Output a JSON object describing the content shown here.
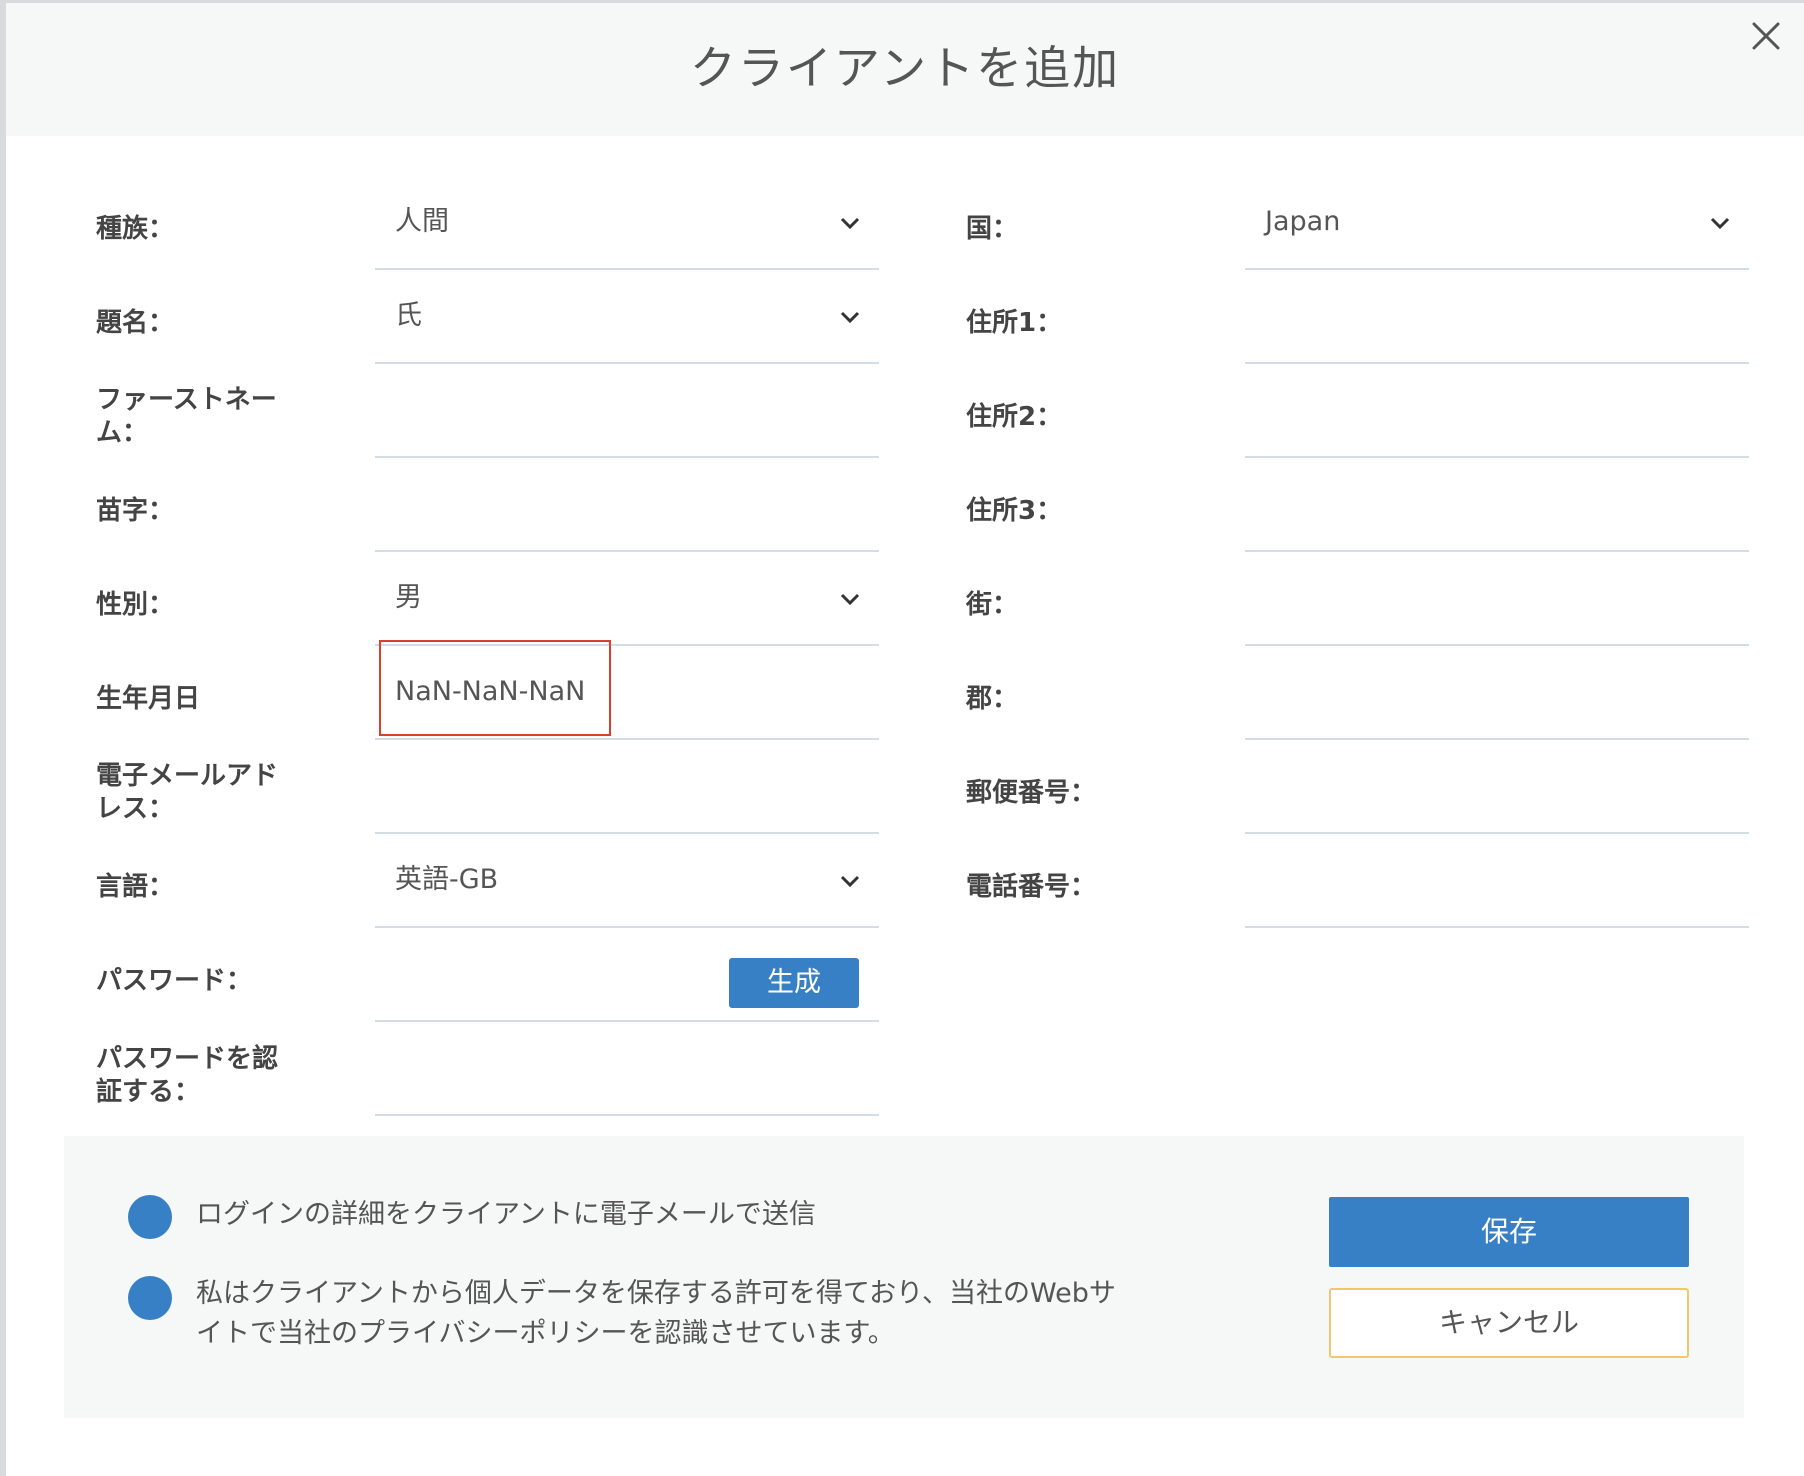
{
  "modal": {
    "title": "クライアントを追加"
  },
  "left": {
    "race": {
      "label": "種族：",
      "value": "人間"
    },
    "title": {
      "label": "題名：",
      "value": "氏"
    },
    "first_name": {
      "label_line1": "ファーストネー",
      "label_line2": "ム：",
      "value": ""
    },
    "last_name": {
      "label": "苗字：",
      "value": ""
    },
    "gender": {
      "label": "性別：",
      "value": "男"
    },
    "dob": {
      "label": "生年月日",
      "value": "NaN-NaN-NaN"
    },
    "email": {
      "label_line1": "電子メールアド",
      "label_line2": "レス：",
      "value": ""
    },
    "language": {
      "label": "言語：",
      "value": "英語-GB"
    },
    "password": {
      "label": "パスワード：",
      "value": "",
      "generate_label": "生成"
    },
    "confirm_password": {
      "label_line1": "パスワードを認",
      "label_line2": "証する：",
      "value": ""
    }
  },
  "right": {
    "country": {
      "label": "国：",
      "value": "Japan"
    },
    "address1": {
      "label": "住所1：",
      "value": ""
    },
    "address2": {
      "label": "住所2：",
      "value": ""
    },
    "address3": {
      "label": "住所3：",
      "value": ""
    },
    "town": {
      "label": "街：",
      "value": ""
    },
    "county": {
      "label": "郡：",
      "value": ""
    },
    "postcode": {
      "label": "郵便番号：",
      "value": ""
    },
    "phone": {
      "label": "電話番号：",
      "value": ""
    }
  },
  "footer": {
    "option1": "ログインの詳細をクライアントに電子メールで送信",
    "option2_line1": "私はクライアントから個人データを保存する許可を得ており、当社のWebサ",
    "option2_line2": "イトで当社のプライバシーポリシーを認識させています。",
    "save_label": "保存",
    "cancel_label": "キャンセル"
  },
  "colors": {
    "accent": "#3880c6",
    "highlight_border": "#d9402f",
    "cancel_border": "#f3c66b"
  }
}
